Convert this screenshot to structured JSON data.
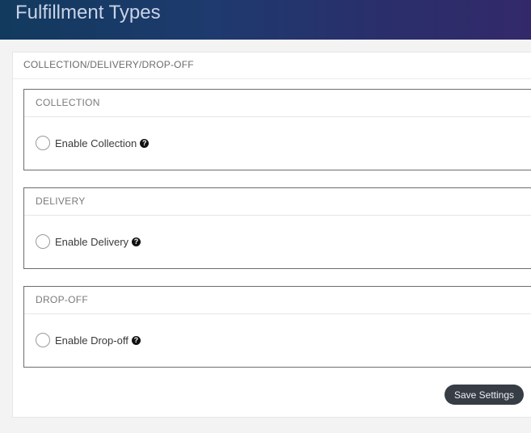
{
  "header": {
    "title": "Fulfillment Types"
  },
  "card": {
    "title": "COLLECTION/DELIVERY/DROP-OFF",
    "sections": [
      {
        "title": "COLLECTION",
        "option_label": "Enable Collection",
        "help_icon": "question-circle-icon"
      },
      {
        "title": "DELIVERY",
        "option_label": "Enable Delivery",
        "help_icon": "question-circle-icon"
      },
      {
        "title": "DROP-OFF",
        "option_label": "Enable Drop-off",
        "help_icon": "question-circle-icon"
      }
    ],
    "save_label": "Save Settings"
  },
  "colors": {
    "header_gradient_start": "#123a5e",
    "header_gradient_end": "#33296a",
    "button_bg": "#363d45"
  }
}
